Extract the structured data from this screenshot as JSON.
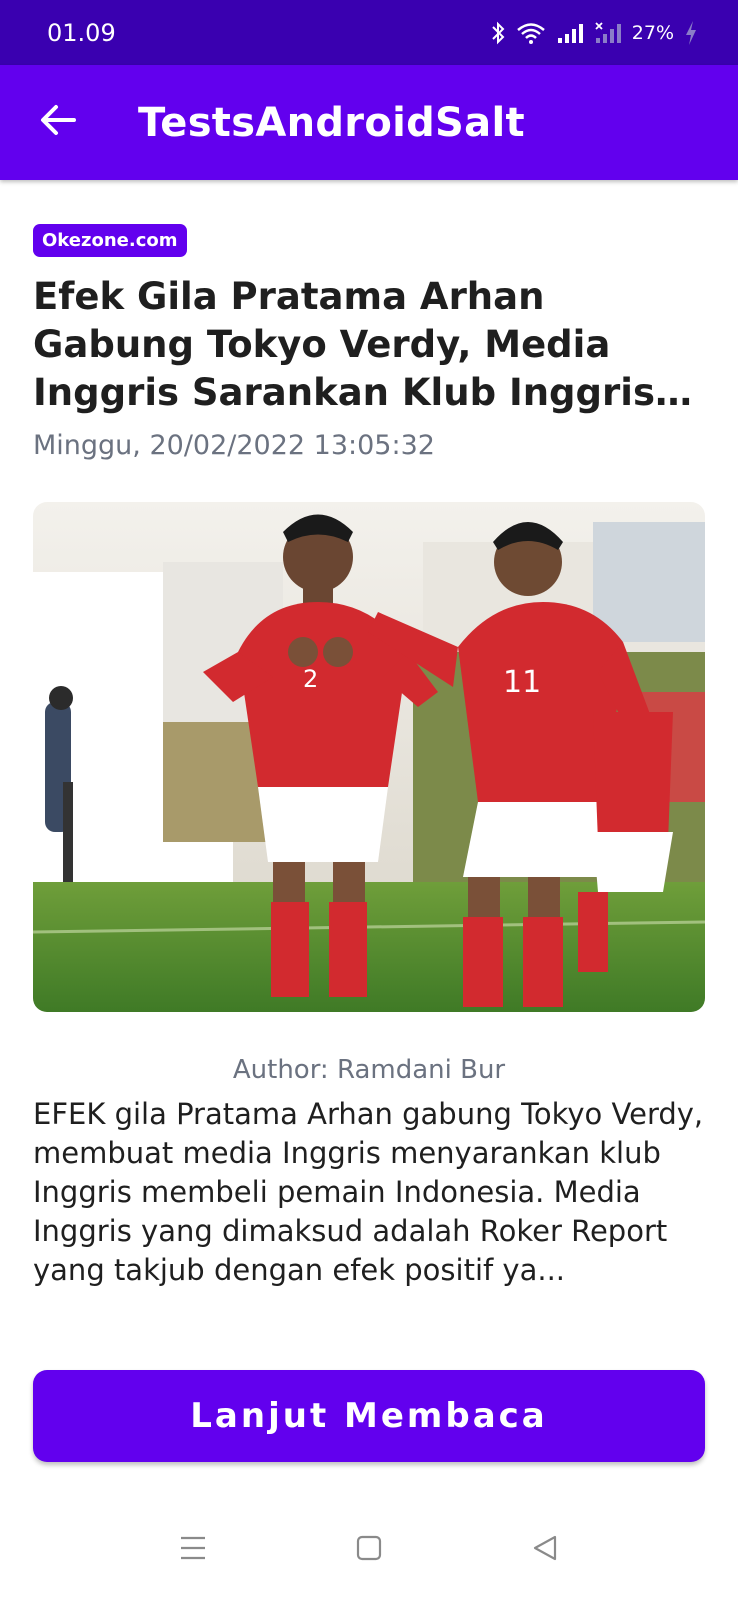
{
  "status_bar": {
    "time": "01.09",
    "battery": "27%",
    "icons": [
      "bluetooth-icon",
      "wifi-icon",
      "signal-icon",
      "signal-off-icon",
      "charging-icon"
    ]
  },
  "app_bar": {
    "title": "TestsAndroidSalt",
    "back_icon": "arrow-left-icon"
  },
  "article": {
    "source": "Okezone.com",
    "title": "Efek Gila Pratama Arhan Gabung Tokyo Verdy, Media Inggris Sarankan Klub Inggris Beli Pemain Indonesia",
    "date": "Minggu, 20/02/2022 13:05:32",
    "author": "Author: Ramdani Bur",
    "excerpt": "EFEK gila Pratama Arhan gabung Tokyo Verdy, membuat media Inggris menyarankan klub Inggris membeli pemain Indonesia. Media Inggris yang dimaksud adalah Roker Report yang takjub dengan efek positif ya...",
    "image": "football-players-celebration-photo"
  },
  "actions": {
    "read_more": "Lanjut Membaca"
  },
  "nav_bar": {
    "icons": [
      "menu-icon",
      "home-icon",
      "back-icon"
    ]
  },
  "colors": {
    "status_bar": "#3a00b0",
    "primary": "#6200ee",
    "text": "#1f1f1f",
    "muted": "#6b7280"
  }
}
